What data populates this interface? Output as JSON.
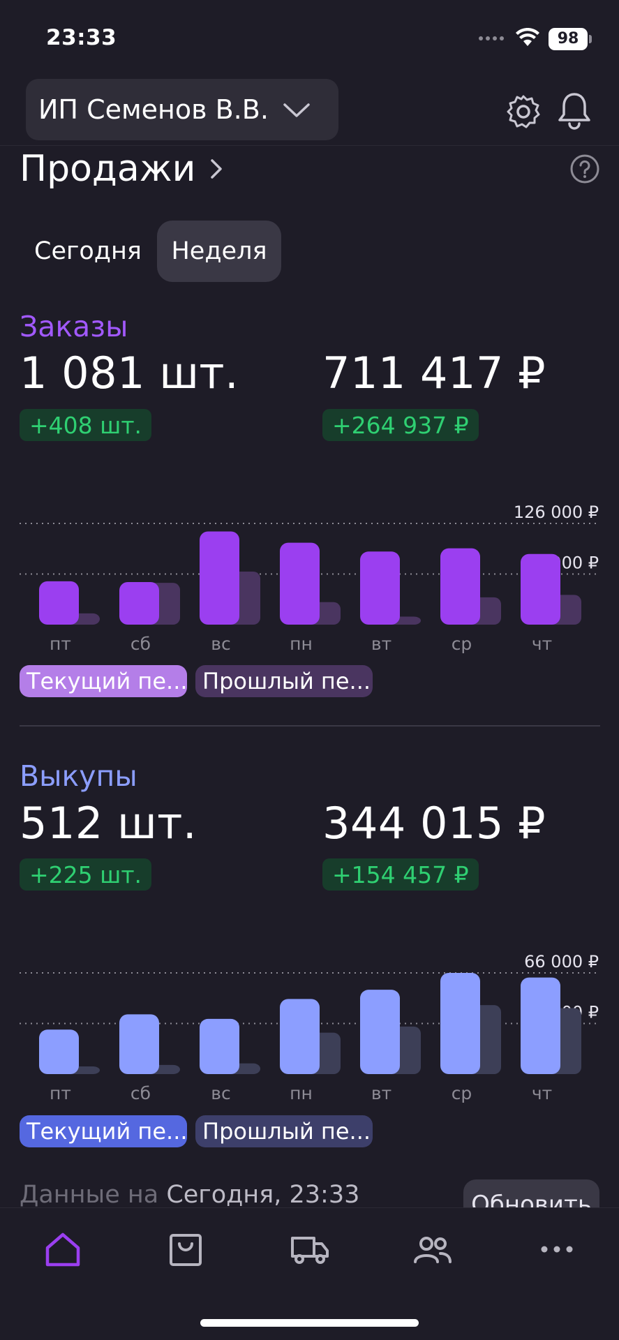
{
  "status_bar": {
    "time": "23:33",
    "battery": "98"
  },
  "header": {
    "seller_name": "ИП Семенов В.В."
  },
  "section": {
    "title": "Продажи"
  },
  "tabs": [
    {
      "label": "Сегодня",
      "selected": false
    },
    {
      "label": "Неделя",
      "selected": true
    }
  ],
  "orders": {
    "label": "Заказы",
    "label_color": "#a259ff",
    "count": "1 081 шт.",
    "count_delta": "+408 шт.",
    "sum": "711 417 ₽",
    "sum_delta": "+264 937 ₽",
    "legend_current": "Текущий пе...",
    "legend_previous": "Прошлый пе...",
    "chart_data": {
      "type": "bar",
      "categories": [
        "пт",
        "сб",
        "вс",
        "пн",
        "вт",
        "ср",
        "чт"
      ],
      "gridline_labels": [
        "126 000 ₽",
        "63 000 ₽"
      ],
      "ylim": [
        0,
        126000
      ],
      "series": [
        {
          "name": "Текущий пе...",
          "color": "#9b3ff0",
          "values": [
            54000,
            53000,
            116000,
            102000,
            91000,
            95000,
            88000
          ]
        },
        {
          "name": "Прошлый пе...",
          "color": "#4a3560",
          "values": [
            14000,
            52000,
            66000,
            28000,
            10000,
            34000,
            37000
          ]
        }
      ],
      "grid": true
    }
  },
  "buyouts": {
    "label": "Выкупы",
    "label_color": "#8c9eff",
    "count": "512 шт.",
    "count_delta": "+225 шт.",
    "sum": "344 015 ₽",
    "sum_delta": "+154 457 ₽",
    "legend_current": "Текущий пе...",
    "legend_previous": "Прошлый пе...",
    "chart_data": {
      "type": "bar",
      "categories": [
        "пт",
        "сб",
        "вс",
        "пн",
        "вт",
        "ср",
        "чт"
      ],
      "gridline_labels": [
        "66 000 ₽",
        "33 000 ₽"
      ],
      "ylim": [
        0,
        66000
      ],
      "series": [
        {
          "name": "Текущий пе...",
          "color": "#8c9eff",
          "values": [
            29000,
            39000,
            36000,
            49000,
            55000,
            66000,
            63000
          ]
        },
        {
          "name": "Прошлый пе...",
          "color": "#3d3f57",
          "values": [
            5000,
            6000,
            7000,
            27000,
            31000,
            45000,
            43000
          ]
        }
      ],
      "grid": true
    }
  },
  "footer": {
    "data_prefix": "Данные на",
    "data_when": "Сегодня, 23:33",
    "refresh_label": "Обновить"
  },
  "tabbar": {
    "active_color": "#9b3ff0",
    "inactive_color": "#b7b5c0",
    "items": [
      "home-icon",
      "bag-icon",
      "truck-icon",
      "users-icon",
      "more-icon"
    ]
  }
}
